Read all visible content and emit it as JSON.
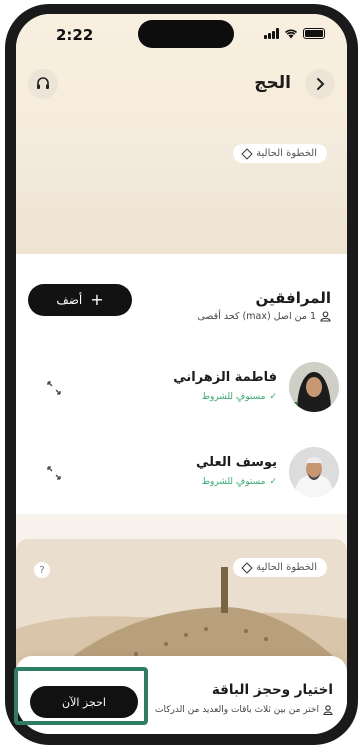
{
  "status_bar": {
    "time": "2:22"
  },
  "header": {
    "title": "الحج"
  },
  "hero": {
    "current_step_label": "الخطوة الحالية"
  },
  "companions": {
    "title": "المرافقين",
    "subtitle": "1 من اصل (max) كحد أقصى",
    "add_button": "أضف",
    "items": [
      {
        "name": "فاطمة الزهراني",
        "status": "مستوفٍ للشروط"
      },
      {
        "name": "يوسف العلي",
        "status": "مستوفٍ للشروط"
      }
    ]
  },
  "next_step": {
    "current_step_label": "الخطوة الحالية",
    "help": "?"
  },
  "package": {
    "title": "اختيار وحجز الباقة",
    "subtitle": "اختر من بين ثلاث باقات والعديد من الدركات",
    "book_button": "احجز الآن"
  },
  "colors": {
    "accent_green": "#2e7d64",
    "status_green": "#3aa872",
    "button_dark": "#121212"
  }
}
